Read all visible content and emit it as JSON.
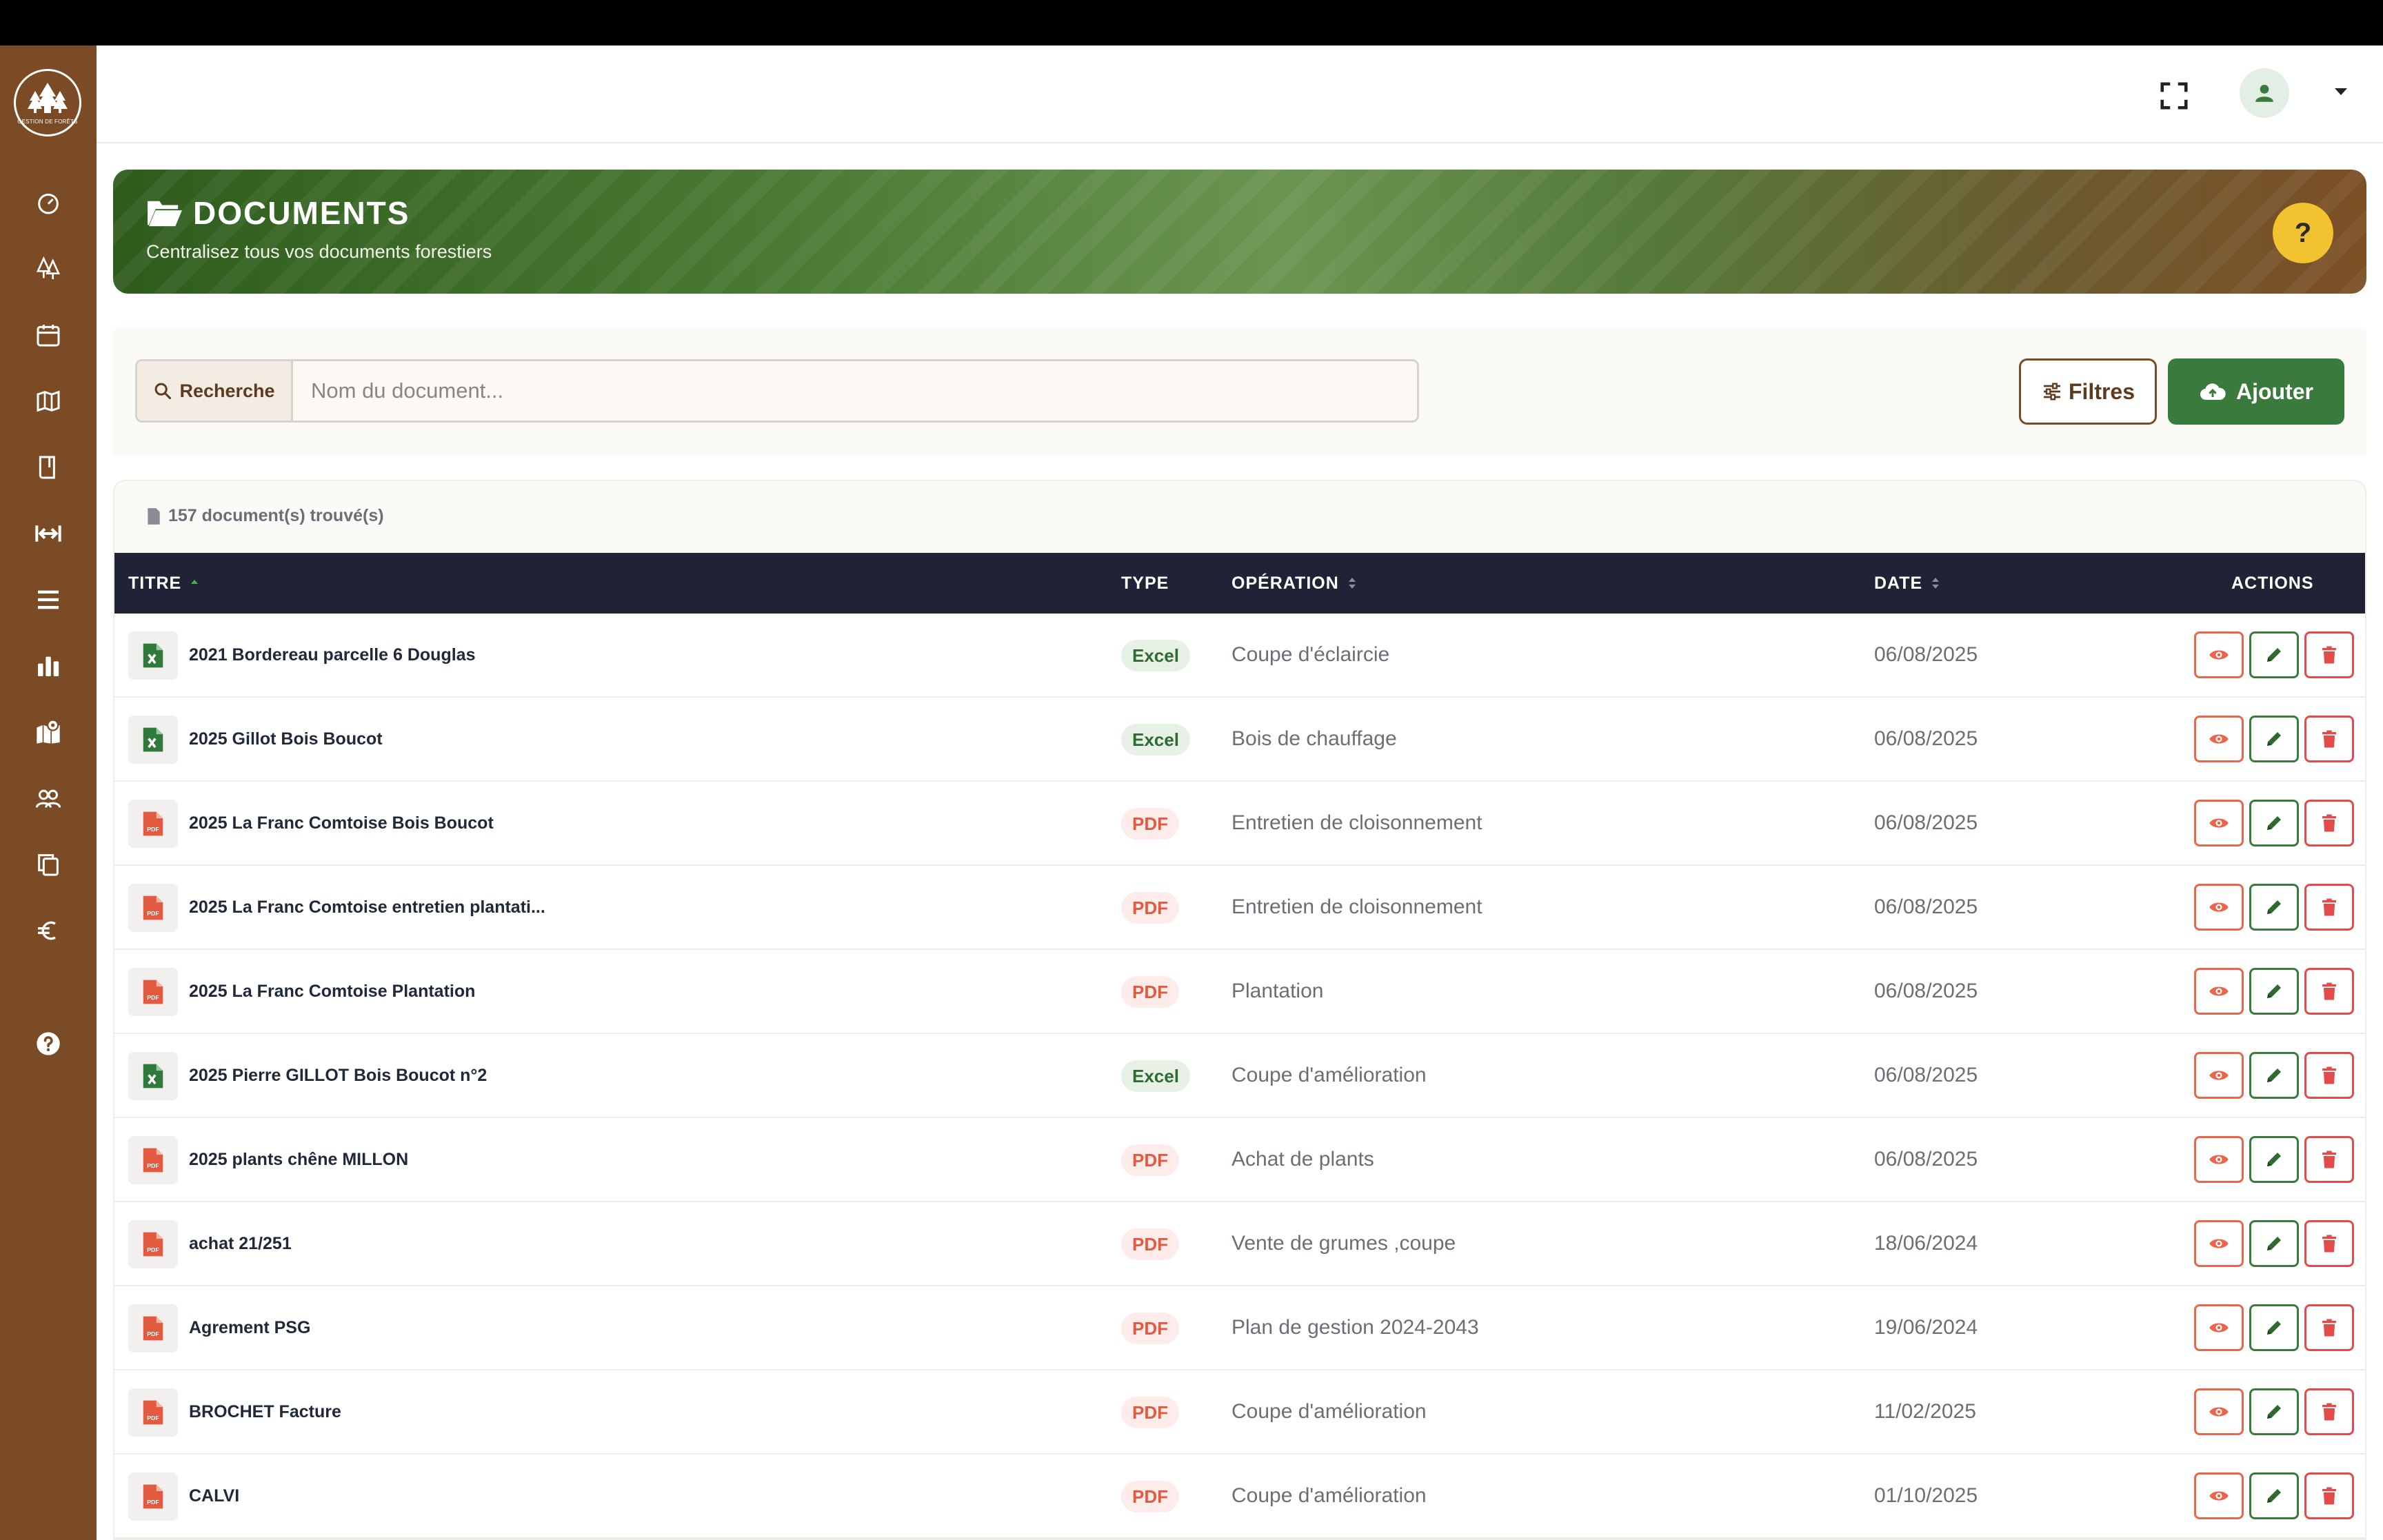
{
  "app": {
    "logo_text": "GESTION DE FORÊTS"
  },
  "sidebar": {
    "items": [
      {
        "icon": "dashboard-gauge-icon"
      },
      {
        "icon": "trees-icon"
      },
      {
        "icon": "calendar-icon"
      },
      {
        "icon": "map-icon"
      },
      {
        "icon": "book-icon"
      },
      {
        "icon": "arrows-horizontal-icon"
      },
      {
        "icon": "menu-bars-icon"
      },
      {
        "icon": "bar-chart-icon"
      },
      {
        "icon": "map-location-icon"
      },
      {
        "icon": "users-icon"
      },
      {
        "icon": "copy-icon"
      },
      {
        "icon": "euro-icon"
      },
      {
        "icon": "help-circle-icon"
      }
    ]
  },
  "topbar": {
    "fullscreen_icon": "fullscreen-icon",
    "user_icon": "user-icon"
  },
  "banner": {
    "title": "DOCUMENTS",
    "subtitle": "Centralisez tous vos documents forestiers",
    "help_label": "?"
  },
  "search": {
    "label": "Recherche",
    "placeholder": "Nom du document...",
    "value": ""
  },
  "buttons": {
    "filters": "Filtres",
    "add": "Ajouter"
  },
  "table": {
    "count_text": "157 document(s) trouvé(s)",
    "headers": {
      "title": "TITRE",
      "type": "TYPE",
      "operation": "OPÉRATION",
      "date": "DATE",
      "actions": "ACTIONS"
    },
    "rows": [
      {
        "title": "2021 Bordereau parcelle 6 Douglas",
        "type": "Excel",
        "operation": "Coupe d'éclaircie",
        "date": "06/08/2025"
      },
      {
        "title": "2025 Gillot Bois Boucot",
        "type": "Excel",
        "operation": "Bois de chauffage",
        "date": "06/08/2025"
      },
      {
        "title": "2025 La Franc Comtoise Bois Boucot",
        "type": "PDF",
        "operation": "Entretien de cloisonnement",
        "date": "06/08/2025"
      },
      {
        "title": "2025 La Franc Comtoise entretien plantati...",
        "type": "PDF",
        "operation": "Entretien de cloisonnement",
        "date": "06/08/2025"
      },
      {
        "title": "2025 La Franc Comtoise Plantation",
        "type": "PDF",
        "operation": "Plantation",
        "date": "06/08/2025"
      },
      {
        "title": "2025 Pierre GILLOT Bois Boucot n°2",
        "type": "Excel",
        "operation": "Coupe d'amélioration",
        "date": "06/08/2025"
      },
      {
        "title": "2025 plants chêne MILLON",
        "type": "PDF",
        "operation": "Achat de plants",
        "date": "06/08/2025"
      },
      {
        "title": "achat 21/251",
        "type": "PDF",
        "operation": "Vente de grumes ,coupe",
        "date": "18/06/2024"
      },
      {
        "title": "Agrement PSG",
        "type": "PDF",
        "operation": "Plan de gestion 2024-2043",
        "date": "19/06/2024"
      },
      {
        "title": "BROCHET Facture",
        "type": "PDF",
        "operation": "Coupe d'amélioration",
        "date": "11/02/2025"
      },
      {
        "title": "CALVI",
        "type": "PDF",
        "operation": "Coupe d'amélioration",
        "date": "01/10/2025"
      }
    ]
  },
  "colors": {
    "sidebar": "#7a4b24",
    "primary_green": "#3a7a3c",
    "table_header": "#1f2335",
    "pdf_red": "#e25a3f",
    "help_yellow": "#f2c230"
  }
}
